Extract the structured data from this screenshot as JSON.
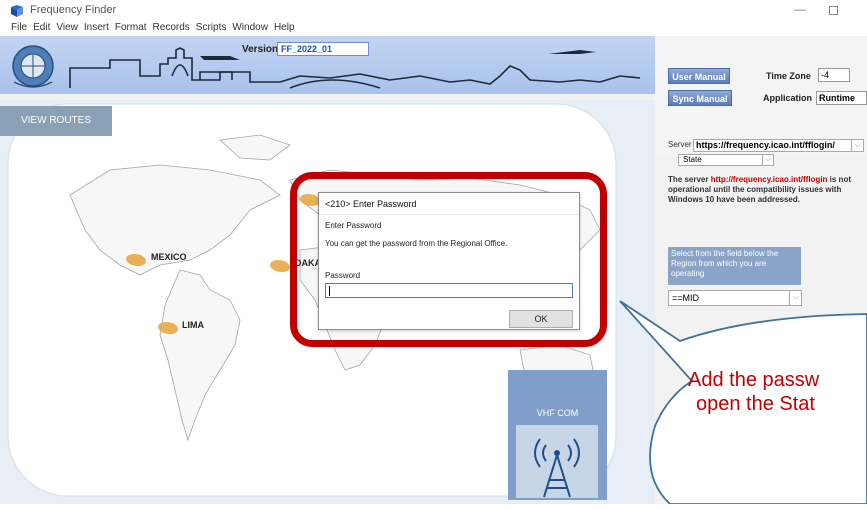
{
  "window": {
    "title": "Frequency Finder",
    "min_glyph": "—"
  },
  "menu": [
    "File",
    "Edit",
    "View",
    "Insert",
    "Format",
    "Records",
    "Scripts",
    "Window",
    "Help"
  ],
  "header": {
    "version_label": "Version",
    "version_value": "FF_2022_01"
  },
  "toolbar": {
    "user_manual": "User Manual",
    "sync_manual": "Sync Manual",
    "time_zone_label": "Time Zone",
    "time_zone_value": "-4",
    "application_label": "Application",
    "application_value": "Runtime"
  },
  "nav": {
    "view_routes": "VIEW ROUTES"
  },
  "server": {
    "label": "Server",
    "value": "https://frequency.icao.int/fflogin/",
    "state_value": "State"
  },
  "notice": {
    "before": "The server ",
    "url": "http://frequency.icao.int/fflogin",
    "after": " is not operational until the compatibility issues with Windows 10 have been addressed."
  },
  "region": {
    "instruction": "Select from the field below the Region from which you are operating",
    "selected": "==MID"
  },
  "map": {
    "cities": [
      "MEXICO",
      "DAKAR",
      "LIMA"
    ]
  },
  "tiles": {
    "vhf_com": "VHF COM"
  },
  "dialog": {
    "title": "<210> Enter Password",
    "subtitle": "Enter Password",
    "message": "You can get the password from the Regional Office.",
    "password_label": "Password",
    "password_value": "",
    "ok_label": "OK"
  },
  "callout": {
    "line1": "Add the passw",
    "line2": "open the Stat"
  },
  "colors": {
    "highlight": "#c00000",
    "callout_fill": "#ffffff",
    "callout_border": "#41719c",
    "tile_bg": "#7f9ec9"
  }
}
